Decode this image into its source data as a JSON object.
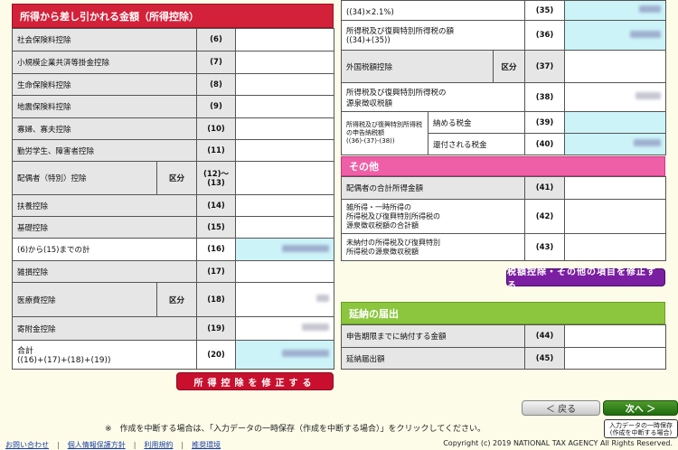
{
  "left_section": {
    "title": "所得から差し引かれる金額（所得控除）",
    "rows": [
      {
        "label": "社会保険料控除",
        "num": "(6)"
      },
      {
        "label": "小規模企業共済等掛金控除",
        "num": "(7)"
      },
      {
        "label": "生命保険料控除",
        "num": "(8)"
      },
      {
        "label": "地震保険料控除",
        "num": "(9)"
      },
      {
        "label": "寡婦、寡夫控除",
        "num": "(10)"
      },
      {
        "label": "勤労学生、障害者控除",
        "num": "(11)"
      },
      {
        "label": "配偶者（特別）控除",
        "kubun": "区分",
        "num": "(12)～(13)"
      },
      {
        "label": "扶養控除",
        "num": "(14)"
      },
      {
        "label": "基礎控除",
        "num": "(15)"
      },
      {
        "label": "(6)から(15)までの計",
        "num": "(16)"
      },
      {
        "label": "雑損控除",
        "num": "(17)"
      },
      {
        "label": "医療費控除",
        "kubun": "区分",
        "num": "(18)"
      },
      {
        "label": "寄附金控除",
        "num": "(19)"
      },
      {
        "label": "合計\n((16)+(17)+(18)+(19))",
        "num": "(20)"
      }
    ],
    "button": "所得控除を修正する"
  },
  "right_top": {
    "rows": [
      {
        "label": "((34)×2.1%)",
        "num": "(35)"
      },
      {
        "label": "所得税及び復興特別所得税の額\n((34)+(35))",
        "num": "(36)"
      },
      {
        "label": "外国税額控除",
        "kubun": "区分",
        "num": "(37)"
      },
      {
        "label": "所得税及び復興特別所得税の\n源泉徴収税額",
        "num": "(38)"
      },
      {
        "label": "所得税及び復興特別所得税の申告納税額\n((36)-(37)-(38))",
        "sub1": "納める税金",
        "num1": "(39)",
        "sub2": "還付される税金",
        "num2": "(40)"
      }
    ]
  },
  "other_section": {
    "title": "その他",
    "rows": [
      {
        "label": "配偶者の合計所得金額",
        "num": "(41)"
      },
      {
        "label": "雑所得・一時所得の\n所得税及び復興特別所得税の\n源泉徴収税額の合計額",
        "num": "(42)"
      },
      {
        "label": "未納付の所得税及び復興特別\n所得税の源泉徴収税額",
        "num": "(43)"
      }
    ],
    "button": "税額控除・その他の項目を修正する"
  },
  "delay_section": {
    "title": "延納の届出",
    "rows": [
      {
        "label": "申告期限までに納付する金額",
        "num": "(44)"
      },
      {
        "label": "延納届出額",
        "num": "(45)"
      }
    ]
  },
  "nav": {
    "back": "＜ 戻る",
    "next": "次へ ＞",
    "save_line1": "入力データの一時保存",
    "save_line2": "(作成を中断する場合)"
  },
  "note": "※　作成を中断する場合は、「入力データの一時保存（作成を中断する場合）」をクリックしてください。",
  "footer": {
    "links": [
      "お問い合わせ",
      "個人情報保護方針",
      "利用規約",
      "推奨環境"
    ],
    "copyright": "Copyright (c) 2019 NATIONAL TAX AGENCY All Rights Reserved."
  }
}
